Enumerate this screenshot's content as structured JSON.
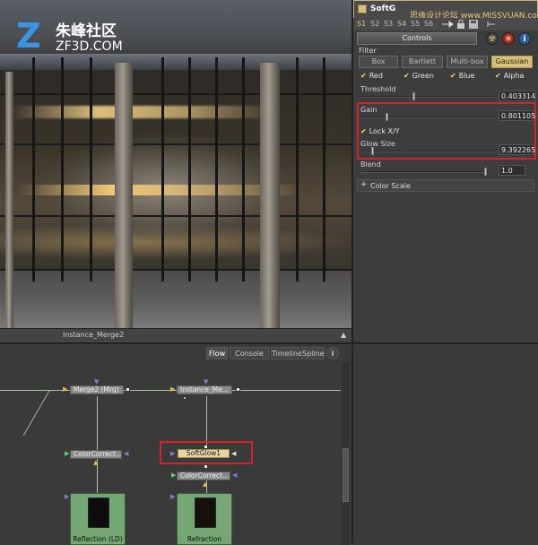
{
  "logo": {
    "mark": "Z",
    "cn": "朱峰社区",
    "en": "ZF3D.COM"
  },
  "viewer": {
    "label": "Instance_Merge2",
    "corner": "▲"
  },
  "inspector": {
    "tool_name": "SoftG",
    "watermark": "思缘设计论坛 www.MISSVUAN.com",
    "slots": [
      "S1",
      "S2",
      "S3",
      "S4",
      "S5",
      "S6"
    ],
    "controls_tab": "Controls",
    "filter_label": "Filter",
    "filter_buttons": [
      "Box",
      "Bartlett",
      "Multi-box",
      "Gaussian"
    ],
    "channels": [
      "Red",
      "Green",
      "Blue",
      "Alpha"
    ],
    "threshold": {
      "label": "Threshold",
      "value": "0.403314",
      "fraction": 0.4
    },
    "gain": {
      "label": "Gain",
      "value": "0.801105",
      "fraction": 0.2
    },
    "lock_xy": "Lock X/Y",
    "glow_size": {
      "label": "Glow Size",
      "value": "9.392265",
      "fraction": 0.09
    },
    "blend": {
      "label": "Blend",
      "value": "1.0",
      "fraction": 1.0
    },
    "color_scale": "Color Scale",
    "color_scale_plus": "+",
    "checkmark": "✔",
    "colors": {
      "accent": "#d9bf79",
      "highlight": "#d0262b",
      "check": "#ffd766"
    }
  },
  "flow": {
    "tabs": [
      "Flow",
      "Console",
      "Timeline",
      "Spline"
    ],
    "info_icon": "i",
    "nodes": {
      "merge2": "Merge2 (Mrg)",
      "instance_merge": "Instance_Me...",
      "color_correct_left": "ColorCorrect...",
      "softglow": "SoftGlow1",
      "color_correct_right": "ColorCorrect...",
      "loader_left": "Reflection  (LD)",
      "loader_right": "Refraction"
    }
  }
}
